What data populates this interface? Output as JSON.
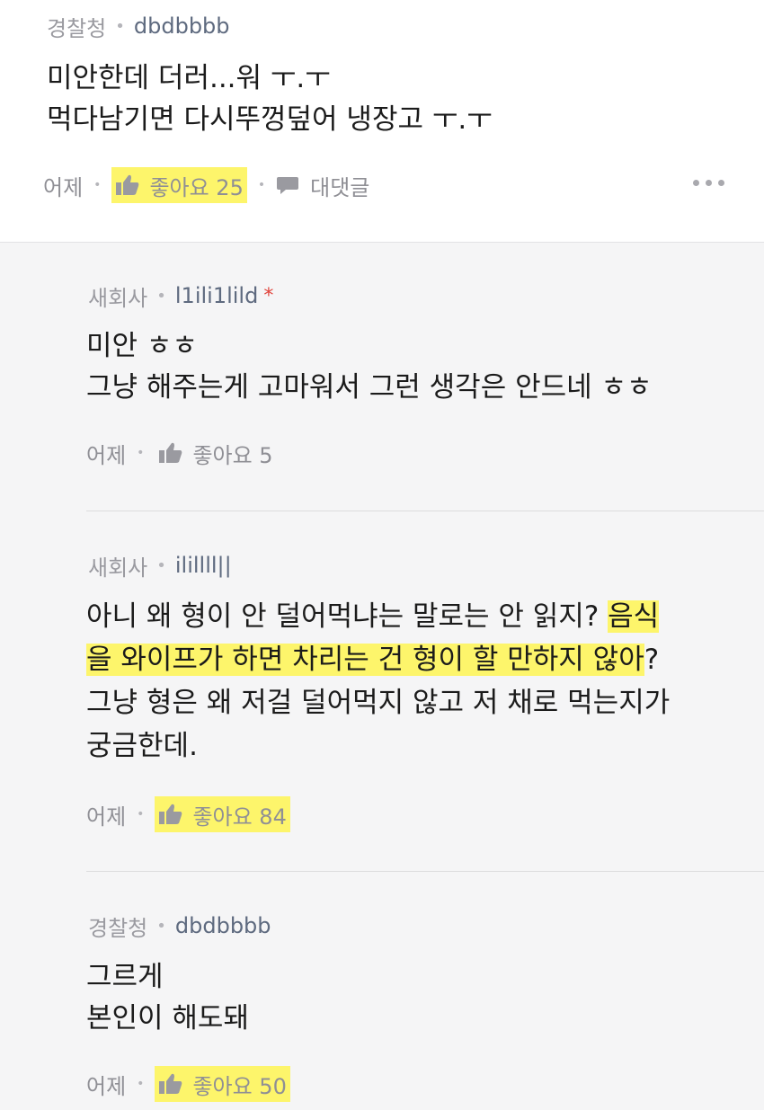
{
  "top_comment": {
    "company": "경찰청",
    "nick": "dbdbbbb",
    "lines": [
      "미안한데 더러...워 ㅜ.ㅜ",
      "먹다남기면 다시뚜껑덮어 냉장고 ㅜ.ㅜ"
    ],
    "time": "어제",
    "like_label": "좋아요 25",
    "reply_label": "대댓글"
  },
  "replies": [
    {
      "company": "새회사",
      "nick": "l1ili1lild",
      "badge": "*",
      "lines": [
        "미안 ㅎㅎ",
        "그냥 해주는게 고마워서 그런 생각은 안드네 ㅎㅎ"
      ],
      "time": "어제",
      "like_label": "좋아요 5"
    },
    {
      "company": "새회사",
      "nick": "ilillll||",
      "line1_plain": "아니 왜 형이 안 덜어먹냐는 말로는 안 읽지? ",
      "line1_hl": "음식",
      "line2_hl": "을 와이프가 하면 차리는 건 형이 할 만하지 않아",
      "line2_plain": "?",
      "line3": "그냥 형은 왜 저걸 덜어먹지 않고 저 채로 먹는지가",
      "line4": "궁금한데.",
      "time": "어제",
      "like_label": "좋아요 84"
    },
    {
      "company": "경찰청",
      "nick": "dbdbbbb",
      "lines": [
        "그르게",
        "본인이 해도돼"
      ],
      "time": "어제",
      "like_label": "좋아요 50"
    }
  ],
  "colors": {
    "highlight": "#fdf56b",
    "nick": "#5e6a7f",
    "badge": "#e0433b",
    "reply_bg": "#f5f5f6"
  },
  "icons": [
    "thumbs-up-icon",
    "speech-bubble-icon",
    "more-icon"
  ]
}
